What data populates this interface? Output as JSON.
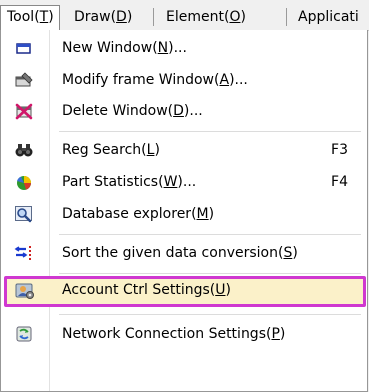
{
  "menubar": {
    "items": [
      {
        "text": "Tool",
        "mnemonic": "T"
      },
      {
        "text": "Draw",
        "mnemonic": "D"
      },
      {
        "text": "Element",
        "mnemonic": "O"
      },
      {
        "text": "Applicati",
        "mnemonic": ""
      }
    ]
  },
  "menu": {
    "items": [
      {
        "label": "New Window",
        "mnemonic": "N",
        "suffix": "...",
        "shortcut": "",
        "icon": "new-window-icon"
      },
      {
        "label": "Modify frame Window",
        "mnemonic": "A",
        "suffix": "...",
        "shortcut": "",
        "icon": "modify-window-icon"
      },
      {
        "label": "Delete Window",
        "mnemonic": "D",
        "suffix": "...",
        "shortcut": "",
        "icon": "delete-window-icon"
      },
      {
        "label": "Reg Search",
        "mnemonic": "L",
        "suffix": "",
        "shortcut": "F3",
        "icon": "binoculars-icon"
      },
      {
        "label": "Part Statistics",
        "mnemonic": "W",
        "suffix": "...",
        "shortcut": "F4",
        "icon": "statistics-icon"
      },
      {
        "label": "Database explorer",
        "mnemonic": "M",
        "suffix": "",
        "shortcut": "",
        "icon": "database-explorer-icon"
      },
      {
        "label": "Sort the given data conversion",
        "mnemonic": "S",
        "suffix": "",
        "shortcut": "",
        "icon": "sort-icon"
      },
      {
        "label": "Account Ctrl Settings",
        "mnemonic": "U",
        "suffix": "",
        "shortcut": "",
        "icon": "account-settings-icon"
      },
      {
        "label": "Network Connection Settings",
        "mnemonic": "P",
        "suffix": "",
        "shortcut": "",
        "icon": "network-settings-icon"
      }
    ]
  },
  "colors": {
    "highlight_border": "#cf38d0",
    "highlight_fill": "#fbf1c9"
  }
}
